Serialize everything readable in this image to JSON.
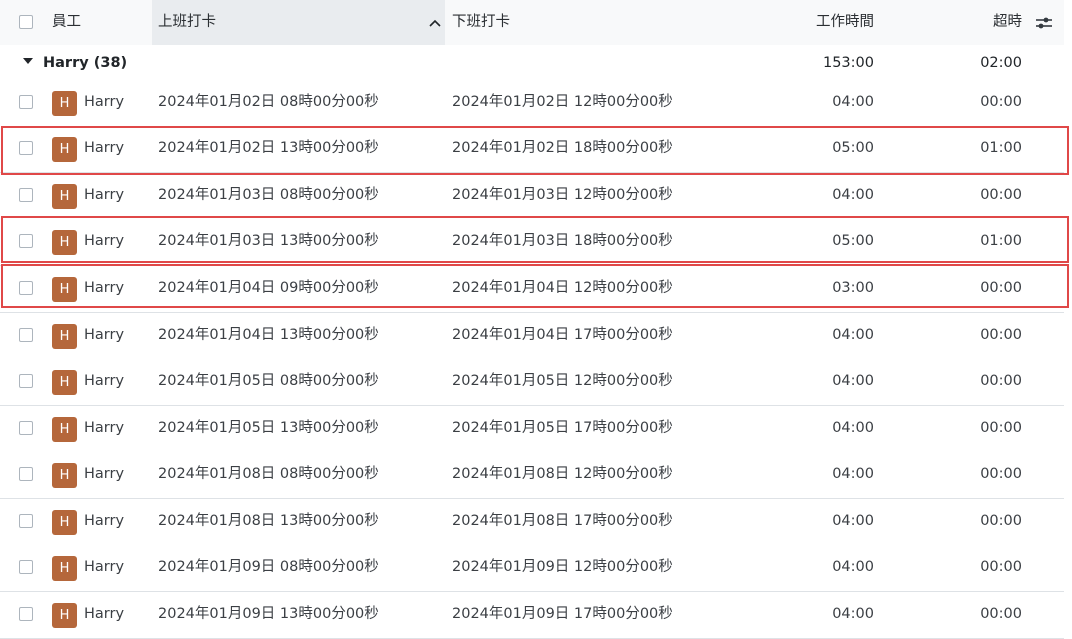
{
  "header": {
    "employee": "員工",
    "check_in": "上班打卡",
    "check_out": "下班打卡",
    "worked_hours": "工作時間",
    "overtime": "超時",
    "sort_icon": "chevron-up-icon",
    "settings_icon": "sliders-icon"
  },
  "group": {
    "name": "Harry (38)",
    "worked_total": "153:00",
    "overtime_total": "02:00"
  },
  "rows": [
    {
      "avatar": "H",
      "employee": "Harry",
      "check_in": "2024年01月02日 08時00分00秒",
      "check_out": "2024年01月02日 12時00分00秒",
      "worked": "04:00",
      "overtime": "00:00"
    },
    {
      "avatar": "H",
      "employee": "Harry",
      "check_in": "2024年01月02日 13時00分00秒",
      "check_out": "2024年01月02日 18時00分00秒",
      "worked": "05:00",
      "overtime": "01:00"
    },
    {
      "avatar": "H",
      "employee": "Harry",
      "check_in": "2024年01月03日 08時00分00秒",
      "check_out": "2024年01月03日 12時00分00秒",
      "worked": "04:00",
      "overtime": "00:00"
    },
    {
      "avatar": "H",
      "employee": "Harry",
      "check_in": "2024年01月03日 13時00分00秒",
      "check_out": "2024年01月03日 18時00分00秒",
      "worked": "05:00",
      "overtime": "01:00"
    },
    {
      "avatar": "H",
      "employee": "Harry",
      "check_in": "2024年01月04日 09時00分00秒",
      "check_out": "2024年01月04日 12時00分00秒",
      "worked": "03:00",
      "overtime": "00:00"
    },
    {
      "avatar": "H",
      "employee": "Harry",
      "check_in": "2024年01月04日 13時00分00秒",
      "check_out": "2024年01月04日 17時00分00秒",
      "worked": "04:00",
      "overtime": "00:00"
    },
    {
      "avatar": "H",
      "employee": "Harry",
      "check_in": "2024年01月05日 08時00分00秒",
      "check_out": "2024年01月05日 12時00分00秒",
      "worked": "04:00",
      "overtime": "00:00"
    },
    {
      "avatar": "H",
      "employee": "Harry",
      "check_in": "2024年01月05日 13時00分00秒",
      "check_out": "2024年01月05日 17時00分00秒",
      "worked": "04:00",
      "overtime": "00:00"
    },
    {
      "avatar": "H",
      "employee": "Harry",
      "check_in": "2024年01月08日 08時00分00秒",
      "check_out": "2024年01月08日 12時00分00秒",
      "worked": "04:00",
      "overtime": "00:00"
    },
    {
      "avatar": "H",
      "employee": "Harry",
      "check_in": "2024年01月08日 13時00分00秒",
      "check_out": "2024年01月08日 17時00分00秒",
      "worked": "04:00",
      "overtime": "00:00"
    },
    {
      "avatar": "H",
      "employee": "Harry",
      "check_in": "2024年01月09日 08時00分00秒",
      "check_out": "2024年01月09日 12時00分00秒",
      "worked": "04:00",
      "overtime": "00:00"
    },
    {
      "avatar": "H",
      "employee": "Harry",
      "check_in": "2024年01月09日 13時00分00秒",
      "check_out": "2024年01月09日 17時00分00秒",
      "worked": "04:00",
      "overtime": "00:00"
    }
  ],
  "highlight_color": "#e04848",
  "avatar_color": "#b5673b"
}
